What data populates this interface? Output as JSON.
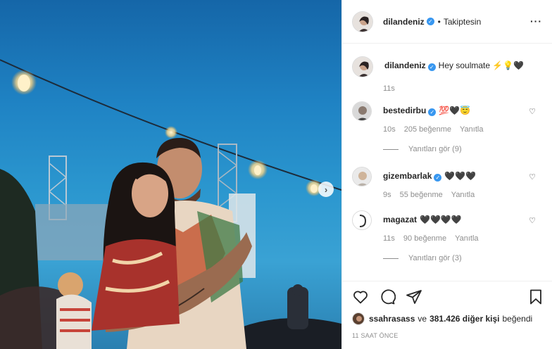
{
  "post": {
    "author": "dilandeniz",
    "follow_status": "Takiptesin",
    "dot": "•",
    "more": "···",
    "next_arrow": "›"
  },
  "caption": {
    "user": "dilandeniz",
    "text": "Hey soulmate ⚡️💡🖤",
    "age": "11s"
  },
  "comments": [
    {
      "user": "bestedirbu",
      "text": "💯🖤😇",
      "age": "10s",
      "likes": "205 beğenme",
      "reply": "Yanıtla",
      "replies": "Yanıtları gör (9)"
    },
    {
      "user": "gizembarlak",
      "text": "🖤🖤🖤",
      "age": "9s",
      "likes": "55 beğenme",
      "reply": "Yanıtla",
      "replies": ""
    },
    {
      "user": "magazat",
      "text": "🖤🖤🖤🖤",
      "age": "11s",
      "likes": "90 beğenme",
      "reply": "Yanıtla",
      "replies": "Yanıtları gör (3)"
    }
  ],
  "likes_line": {
    "user": "ssahrasass",
    "middle": "ve",
    "others": "381.426 diğer kişi",
    "suffix": "beğendi"
  },
  "timestamp": "11 SAAT ÖNCE",
  "icons": [
    "heart-icon",
    "comment-icon",
    "share-icon",
    "bookmark-icon"
  ],
  "colors": {
    "verified": "#3897f0",
    "muted": "#8e8e8e",
    "text": "#262626"
  }
}
